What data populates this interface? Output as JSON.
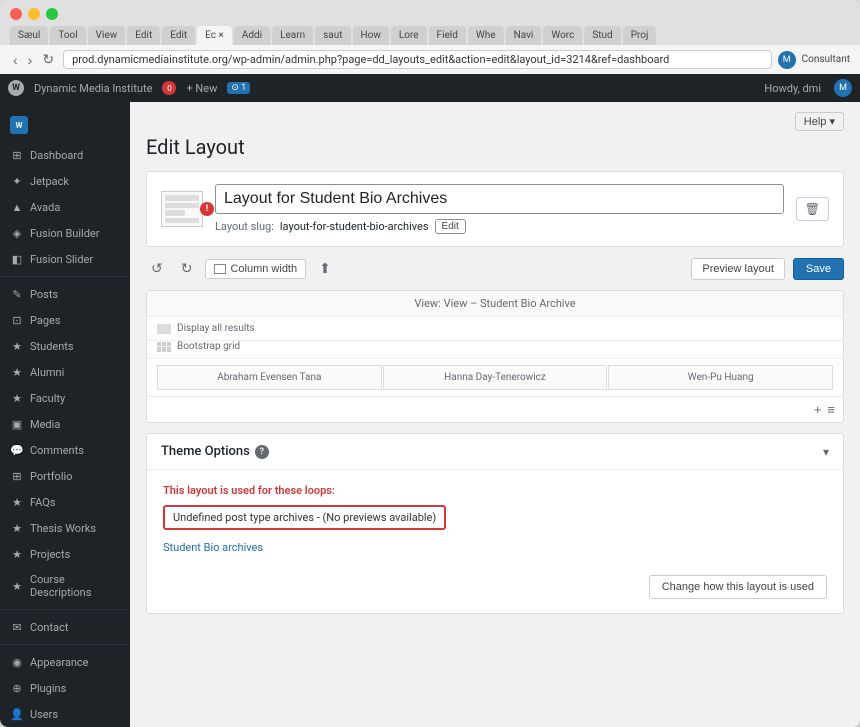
{
  "browser": {
    "tabs": [
      {
        "label": "Sæul",
        "active": false
      },
      {
        "label": "Tool",
        "active": false
      },
      {
        "label": "View",
        "active": false
      },
      {
        "label": "Edit",
        "active": false
      },
      {
        "label": "Edit",
        "active": false
      },
      {
        "label": "Ec ×",
        "active": true
      },
      {
        "label": "Addi",
        "active": false
      },
      {
        "label": "Learn",
        "active": false
      },
      {
        "label": "saut",
        "active": false
      },
      {
        "label": "How",
        "active": false
      },
      {
        "label": "Lore",
        "active": false
      },
      {
        "label": "Field",
        "active": false
      },
      {
        "label": "Whe",
        "active": false
      },
      {
        "label": "Navi",
        "active": false
      },
      {
        "label": "Worc",
        "active": false
      },
      {
        "label": "Stud",
        "active": false
      },
      {
        "label": "Proj",
        "active": false
      }
    ],
    "url": "prod.dynamicmediainstitute.org/wp-admin/admin.php?page=dd_layouts_edit&action=edit&layout_id=3214&ref=dashboard",
    "user_badge": "M"
  },
  "admin_bar": {
    "items": [
      "Dynamic Media Institute",
      "0",
      "+ New",
      "⊙ 1"
    ],
    "howdy": "Howdy, dmi"
  },
  "sidebar": {
    "logo": "Dynamic Media Institute",
    "items": [
      {
        "label": "Dashboard",
        "icon": "⊞"
      },
      {
        "label": "Jetpack",
        "icon": "✦"
      },
      {
        "label": "Avada",
        "icon": "▲"
      },
      {
        "label": "Fusion Builder",
        "icon": "◈"
      },
      {
        "label": "Fusion Slider",
        "icon": "◧"
      },
      {
        "label": "Posts",
        "icon": "✎"
      },
      {
        "label": "Pages",
        "icon": "⊡"
      },
      {
        "label": "Students",
        "icon": "★"
      },
      {
        "label": "Alumni",
        "icon": "★"
      },
      {
        "label": "Faculty",
        "icon": "★"
      },
      {
        "label": "Media",
        "icon": "▣"
      },
      {
        "label": "Comments",
        "icon": "💬"
      },
      {
        "label": "Portfolio",
        "icon": "⊞"
      },
      {
        "label": "FAQs",
        "icon": "★"
      },
      {
        "label": "Thesis Works",
        "icon": "★"
      },
      {
        "label": "Projects",
        "icon": "★"
      },
      {
        "label": "Course Descriptions",
        "icon": "★"
      },
      {
        "label": "Contact",
        "icon": "✉"
      },
      {
        "label": "Appearance",
        "icon": "◉"
      },
      {
        "label": "Plugins",
        "icon": "⊕"
      },
      {
        "label": "Users",
        "icon": "👤"
      }
    ]
  },
  "page": {
    "title": "Edit Layout",
    "help_label": "Help ▾"
  },
  "layout": {
    "name": "Layout for Student Bio Archives",
    "slug_label": "Layout slug:",
    "slug_value": "layout-for-student-bio-archives",
    "slug_edit": "Edit",
    "info_dot": "!",
    "delete_icon": "🗑"
  },
  "toolbar": {
    "undo_icon": "↺",
    "redo_icon": "↻",
    "column_width_label": "Column width",
    "export_icon": "⬆",
    "preview_label": "Preview layout",
    "save_label": "Save"
  },
  "preview_area": {
    "header": "View: View – Student Bio Archive",
    "display_all": "Display all results",
    "bootstrap_grid": "Bootstrap grid",
    "cells": [
      "Abraham Evensen Tana",
      "Hanna Day-Tenerowicz",
      "Wen-Pu Huang"
    ],
    "add_icon": "+",
    "menu_icon": "≡"
  },
  "theme_options": {
    "title": "Theme Options",
    "info_icon": "?",
    "chevron": "▾",
    "loops_label": "This layout is used for these loops:",
    "loops_value": "Undefined post type archives - (No previews available)",
    "link_label": "Student Bio archives",
    "change_btn": "Change how this layout is used"
  }
}
